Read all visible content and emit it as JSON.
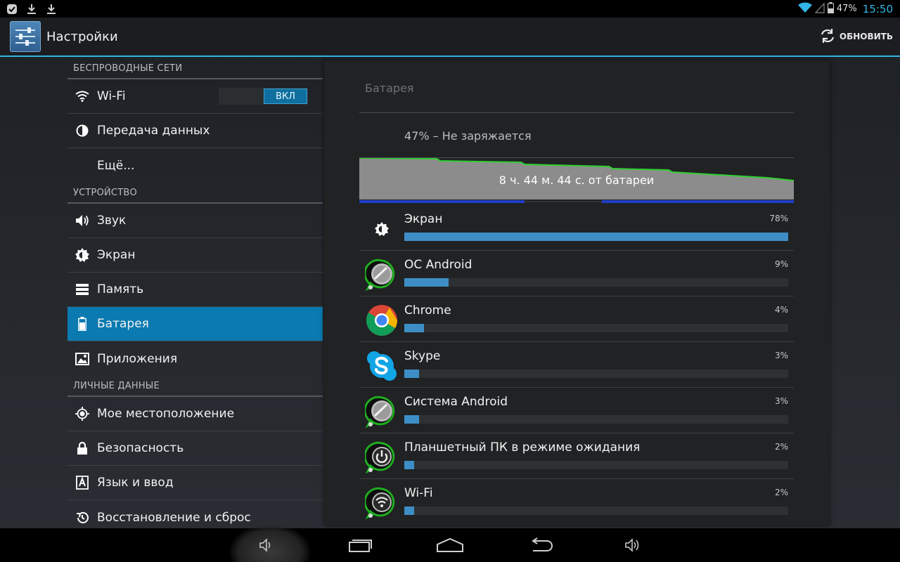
{
  "statusbar": {
    "battery_text": "47%",
    "time": "15:50",
    "left_icons": [
      "checkmark-notification-icon",
      "download-icon",
      "download-icon"
    ],
    "right_icons": [
      "wifi-icon",
      "signal-icon",
      "battery-icon"
    ]
  },
  "actionbar": {
    "title": "Настройки",
    "refresh_label": "ОБНОВИТЬ"
  },
  "sections": [
    {
      "header": "БЕСПРОВОДНЫЕ СЕТИ",
      "items": [
        {
          "label": "Wi-Fi",
          "icon": "wifi-icon",
          "toggle": "ВКЛ"
        },
        {
          "label": "Передача данных",
          "icon": "data-usage-icon"
        },
        {
          "label": "Ещё...",
          "icon": ""
        }
      ]
    },
    {
      "header": "УСТРОЙСТВО",
      "items": [
        {
          "label": "Звук",
          "icon": "volume-icon"
        },
        {
          "label": "Экран",
          "icon": "brightness-icon"
        },
        {
          "label": "Память",
          "icon": "storage-icon"
        },
        {
          "label": "Батарея",
          "icon": "battery-icon",
          "active": true
        },
        {
          "label": "Приложения",
          "icon": "apps-icon"
        }
      ]
    },
    {
      "header": "ЛИЧНЫЕ ДАННЫЕ",
      "items": [
        {
          "label": "Мое местоположение",
          "icon": "location-icon"
        },
        {
          "label": "Безопасность",
          "icon": "lock-icon"
        },
        {
          "label": "Язык и ввод",
          "icon": "language-icon"
        },
        {
          "label": "Восстановление и сброс",
          "icon": "restore-icon"
        }
      ]
    }
  ],
  "battery": {
    "title": "Батарея",
    "status": "47% – Не заряжается",
    "graph_label": "8 ч. 44 м. 44 с. от батареи",
    "colors": {
      "graph_fill": "#8c8c8c",
      "graph_line": "#2fd12f",
      "bar_fill": "#3d8ec6",
      "accent": "#33b5e5"
    },
    "usage": [
      {
        "name": "Экран",
        "percent": "78%",
        "value": 78,
        "icon": "brightness-icon"
      },
      {
        "name": "ОС Android",
        "percent": "9%",
        "value": 9,
        "icon": "android-os-icon"
      },
      {
        "name": "Chrome",
        "percent": "4%",
        "value": 4,
        "icon": "chrome-icon"
      },
      {
        "name": "Skype",
        "percent": "3%",
        "value": 3,
        "icon": "skype-icon"
      },
      {
        "name": "Система Android",
        "percent": "3%",
        "value": 3,
        "icon": "android-system-icon"
      },
      {
        "name": "Планшетный ПК в режиме ожидания",
        "percent": "2%",
        "value": 2,
        "icon": "standby-icon"
      },
      {
        "name": "Wi-Fi",
        "percent": "2%",
        "value": 2,
        "icon": "wifi-usage-icon"
      }
    ]
  },
  "navbar": {
    "buttons": [
      "volume-down-icon",
      "recent-apps-icon",
      "home-icon",
      "back-icon",
      "volume-up-icon"
    ]
  }
}
